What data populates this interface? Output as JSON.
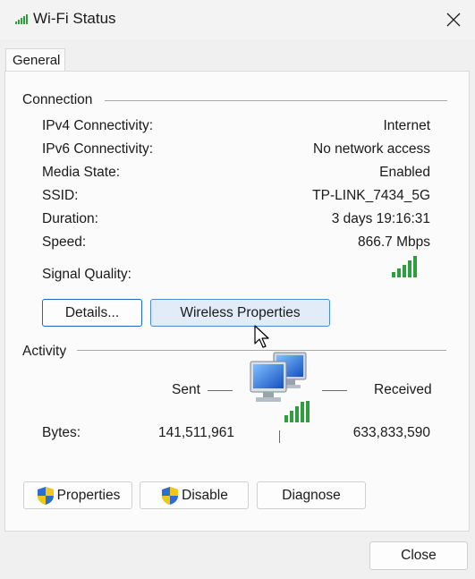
{
  "window": {
    "title": "Wi-Fi Status",
    "close_glyph": "✕",
    "icon": "wifi-signal-icon"
  },
  "tabs": [
    {
      "label": "General",
      "selected": true
    }
  ],
  "connection": {
    "heading": "Connection",
    "rows": [
      {
        "label": "IPv4 Connectivity:",
        "value": "Internet"
      },
      {
        "label": "IPv6 Connectivity:",
        "value": "No network access"
      },
      {
        "label": "Media State:",
        "value": "Enabled"
      },
      {
        "label": "SSID:",
        "value": "TP-LINK_7434_5G"
      },
      {
        "label": "Duration:",
        "value": "3 days 19:16:31"
      },
      {
        "label": "Speed:",
        "value": "866.7 Mbps"
      }
    ],
    "signal_label": "Signal Quality:",
    "signal_bars": 5,
    "details_label": "Details...",
    "wireless_properties_label": "Wireless Properties"
  },
  "activity": {
    "heading": "Activity",
    "sent_label": "Sent",
    "received_label": "Received",
    "bytes_label": "Bytes:",
    "sent_bytes": "141,511,961",
    "received_bytes": "633,833,590"
  },
  "actions": {
    "properties_label": "Properties",
    "disable_label": "Disable",
    "diagnose_label": "Diagnose"
  },
  "footer": {
    "close_label": "Close"
  },
  "colors": {
    "signal_green": "#2e9e3e",
    "accent_blue": "#1d68c7",
    "hover_bg": "#e1ecf8"
  }
}
